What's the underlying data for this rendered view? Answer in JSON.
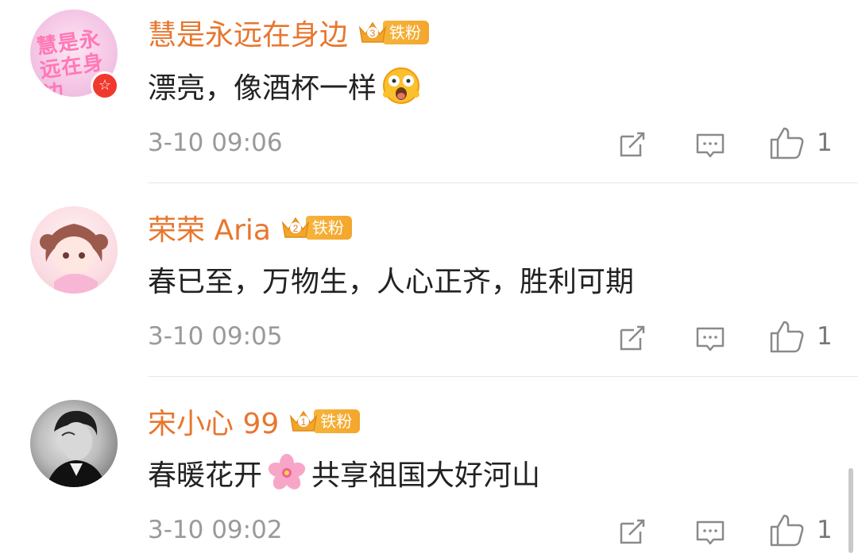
{
  "comments": [
    {
      "avatar_text": "慧是永远在身边",
      "username": "慧是永远在身边",
      "fan_level": "3",
      "fan_label": "铁粉",
      "text": "漂亮，像酒杯一样",
      "emoji_after": "shocked-face",
      "timestamp": "3-10 09:06",
      "likes": "1",
      "verified_badge": "☆"
    },
    {
      "username": "荣荣 Aria",
      "fan_level": "2",
      "fan_label": "铁粉",
      "text": "春已至，万物生，人心正齐，胜利可期",
      "timestamp": "3-10 09:05",
      "likes": "1"
    },
    {
      "username": "宋小心 99",
      "fan_level": "1",
      "fan_label": "铁粉",
      "text_before": "春暖花开",
      "emoji_mid": "cherry-blossom",
      "text_after": "共享祖国大好河山",
      "timestamp": "3-10 09:02",
      "likes": "1"
    }
  ],
  "colors": {
    "username": "#e8762f",
    "fan_badge": "#f3a62c",
    "text": "#222222",
    "meta": "#9a9a9a",
    "divider": "#e6e6e6"
  },
  "icons": [
    "share-icon",
    "reply-icon",
    "thumbs-up-icon"
  ]
}
